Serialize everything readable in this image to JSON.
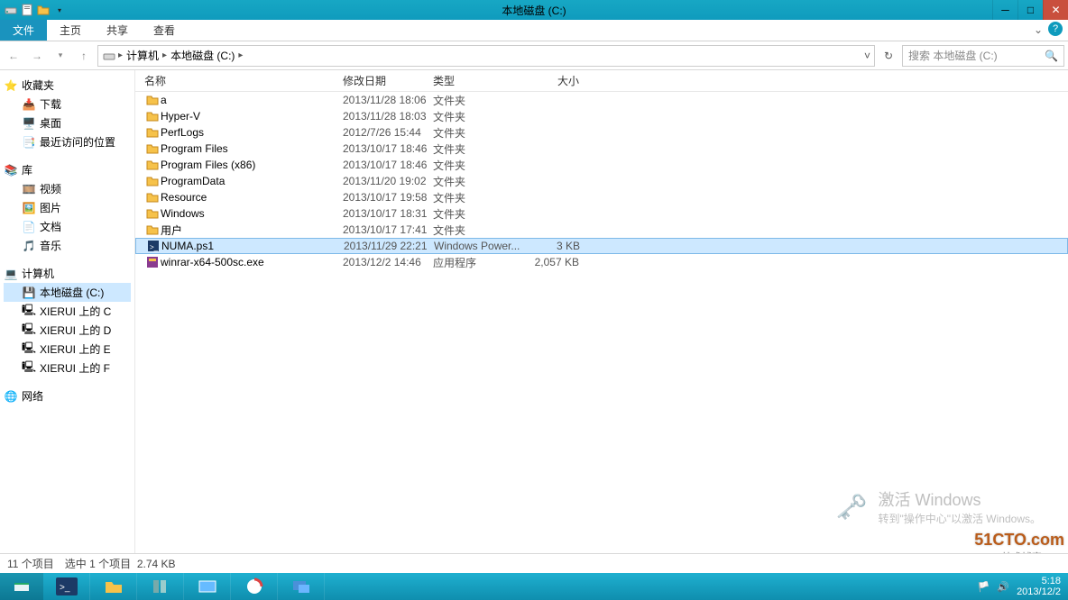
{
  "window": {
    "title": "本地磁盘 (C:)"
  },
  "ribbon": {
    "file": "文件",
    "home": "主页",
    "share": "共享",
    "view": "查看"
  },
  "address": {
    "root_icon": "drive-icon",
    "crumb1": "计算机",
    "crumb2": "本地磁盘 (C:)"
  },
  "search": {
    "placeholder": "搜索 本地磁盘 (C:)"
  },
  "nav": {
    "favorites": {
      "label": "收藏夹",
      "items": [
        {
          "icon": "download-icon",
          "label": "下载"
        },
        {
          "icon": "desktop-icon",
          "label": "桌面"
        },
        {
          "icon": "recent-icon",
          "label": "最近访问的位置"
        }
      ]
    },
    "libraries": {
      "label": "库",
      "items": [
        {
          "icon": "video-icon",
          "label": "视频"
        },
        {
          "icon": "picture-icon",
          "label": "图片"
        },
        {
          "icon": "document-icon",
          "label": "文档"
        },
        {
          "icon": "music-icon",
          "label": "音乐"
        }
      ]
    },
    "computer": {
      "label": "计算机",
      "items": [
        {
          "icon": "drive-icon",
          "label": "本地磁盘 (C:)",
          "selected": true
        },
        {
          "icon": "netdrive-icon",
          "label": "XIERUI 上的 C"
        },
        {
          "icon": "netdrive-icon",
          "label": "XIERUI 上的 D"
        },
        {
          "icon": "netdrive-icon",
          "label": "XIERUI 上的 E"
        },
        {
          "icon": "netdrive-icon",
          "label": "XIERUI 上的 F"
        }
      ]
    },
    "network": {
      "label": "网络"
    }
  },
  "columns": {
    "name": "名称",
    "date": "修改日期",
    "type": "类型",
    "size": "大小"
  },
  "files": [
    {
      "icon": "folder",
      "name": "a",
      "date": "2013/11/28 18:06",
      "type": "文件夹",
      "size": ""
    },
    {
      "icon": "folder",
      "name": "Hyper-V",
      "date": "2013/11/28 18:03",
      "type": "文件夹",
      "size": ""
    },
    {
      "icon": "folder",
      "name": "PerfLogs",
      "date": "2012/7/26 15:44",
      "type": "文件夹",
      "size": ""
    },
    {
      "icon": "folder",
      "name": "Program Files",
      "date": "2013/10/17 18:46",
      "type": "文件夹",
      "size": ""
    },
    {
      "icon": "folder",
      "name": "Program Files (x86)",
      "date": "2013/10/17 18:46",
      "type": "文件夹",
      "size": ""
    },
    {
      "icon": "folder",
      "name": "ProgramData",
      "date": "2013/11/20 19:02",
      "type": "文件夹",
      "size": ""
    },
    {
      "icon": "folder",
      "name": "Resource",
      "date": "2013/10/17 19:58",
      "type": "文件夹",
      "size": ""
    },
    {
      "icon": "folder",
      "name": "Windows",
      "date": "2013/10/17 18:31",
      "type": "文件夹",
      "size": ""
    },
    {
      "icon": "folder",
      "name": "用户",
      "date": "2013/10/17 17:41",
      "type": "文件夹",
      "size": ""
    },
    {
      "icon": "ps1",
      "name": "NUMA.ps1",
      "date": "2013/11/29 22:21",
      "type": "Windows Power...",
      "size": "3 KB",
      "selected": true
    },
    {
      "icon": "exe",
      "name": "winrar-x64-500sc.exe",
      "date": "2013/12/2 14:46",
      "type": "应用程序",
      "size": "2,057 KB"
    }
  ],
  "activate": {
    "line1": "激活 Windows",
    "line2": "转到\"操作中心\"以激活 Windows。"
  },
  "status": {
    "count": "11 个项目",
    "selected": "选中 1 个项目",
    "size": "2.74 KB"
  },
  "tray": {
    "time": "5:18",
    "date": "2013/12/2"
  },
  "watermark": {
    "main": "51CTO.com",
    "sub": "技术博客 Blog"
  }
}
